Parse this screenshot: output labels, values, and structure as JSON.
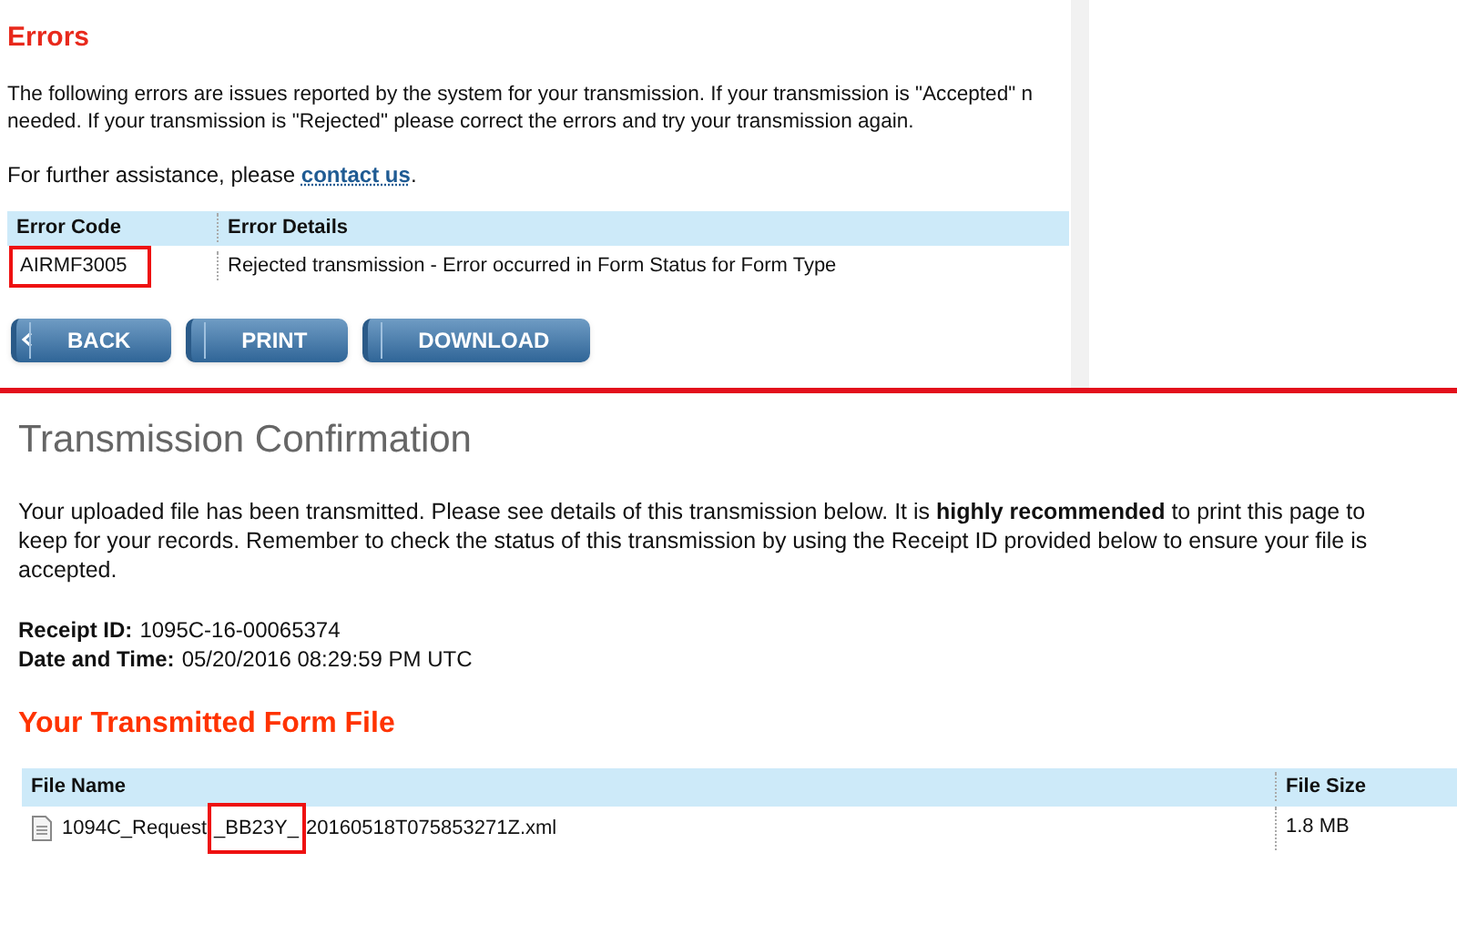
{
  "errors_panel": {
    "title": "Errors",
    "description": "The following errors are issues reported by the system for your transmission. If your transmission is \"Accepted\" n",
    "description_line2": "needed. If your transmission is \"Rejected\" please correct the errors and try your transmission again.",
    "assistance_text": "For further assistance, please",
    "assistance_link": "contact us",
    "assistance_end": ".",
    "table": {
      "columns": [
        "Error Code",
        "Error Details"
      ],
      "rows": [
        {
          "code": "AIRMF3005",
          "details": "Rejected transmission - Error occurred in Form Status for Form Type",
          "highlighted": true
        }
      ]
    },
    "buttons": [
      {
        "label": "BACK",
        "kind": "back"
      },
      {
        "label": "PRINT",
        "kind": "plain"
      },
      {
        "label": "DOWNLOAD",
        "kind": "plain"
      }
    ]
  },
  "confirmation": {
    "title": "Transmission Confirmation",
    "message": "Your uploaded file has been transmitted. Please see details of this transmission below. It is **highly recommended** to print this page to keep for your records. Remember to check the status of this transmission by using the Receipt ID provided below to ensure your file is accepted.",
    "details": [
      {
        "label": "Receipt ID:",
        "value": "1095C-16-00065374"
      },
      {
        "label": "Date and Time:",
        "value": "05/20/2016 08:29:59 PM UTC"
      }
    ],
    "section_title": "Your Transmitted Form File",
    "table": {
      "columns": [
        "File Name",
        "File Size"
      ],
      "rows": [
        {
          "file_name_parts": [
            {
              "text": "1094C_Request",
              "highlighted": false
            },
            {
              "text": "_BB23Y_",
              "highlighted": true
            },
            {
              "text": "20160518T075853271Z.xml",
              "highlighted": false
            }
          ],
          "size": "1.8 MB"
        }
      ]
    }
  }
}
